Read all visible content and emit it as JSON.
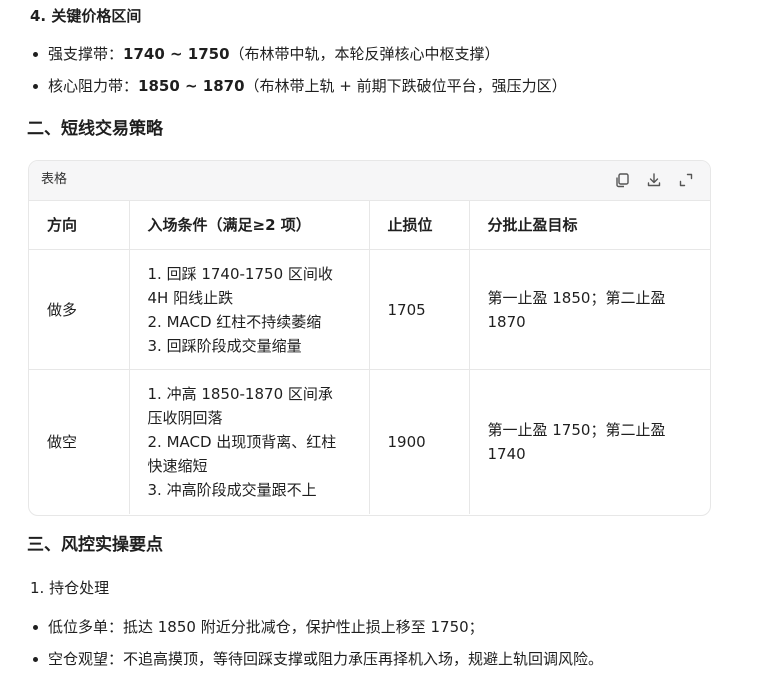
{
  "section4": {
    "title": "4. 关键价格区间",
    "items": [
      {
        "label": "强支撑带：",
        "range": "1740 ~ 1750",
        "note": "（布林带中轨，本轮反弹核心中枢支撑）"
      },
      {
        "label": "核心阻力带：",
        "range": "1850 ~ 1870",
        "note": "（布林带上轨 + 前期下跌破位平台，强压力区）"
      }
    ]
  },
  "section_two_title": "二、短线交易策略",
  "table": {
    "label": "表格",
    "icons": {
      "copy": "copy-icon",
      "download": "download-icon",
      "expand": "expand-icon"
    },
    "headers": [
      "方向",
      "入场条件（满足≥2 项）",
      "止损位",
      "分批止盈目标"
    ],
    "rows": [
      {
        "direction": "做多",
        "conditions": [
          "1. 回踩 1740-1750 区间收",
          "4H 阳线止跌",
          "2. MACD 红柱不持续萎缩",
          "3. 回踩阶段成交量缩量"
        ],
        "stop": "1705",
        "targets": [
          "第一止盈 1850；第二止盈",
          "1870"
        ]
      },
      {
        "direction": "做空",
        "conditions": [
          "1. 冲高 1850-1870 区间承",
          "压收阴回落",
          "2. MACD 出现顶背离、红柱",
          "快速缩短",
          "3. 冲高阶段成交量跟不上"
        ],
        "stop": "1900",
        "targets": [
          "第一止盈 1750；第二止盈",
          "1740"
        ]
      }
    ]
  },
  "section_three_title": "三、风控实操要点",
  "sub_title": "1. 持仓处理",
  "risk_items": [
    "低位多单：抵达 1850 附近分批减仓，保护性止损上移至 1750；",
    "空仓观望：不追高摸顶，等待回踩支撑或阻力承压再择机入场，规避上轨回调风险。"
  ]
}
